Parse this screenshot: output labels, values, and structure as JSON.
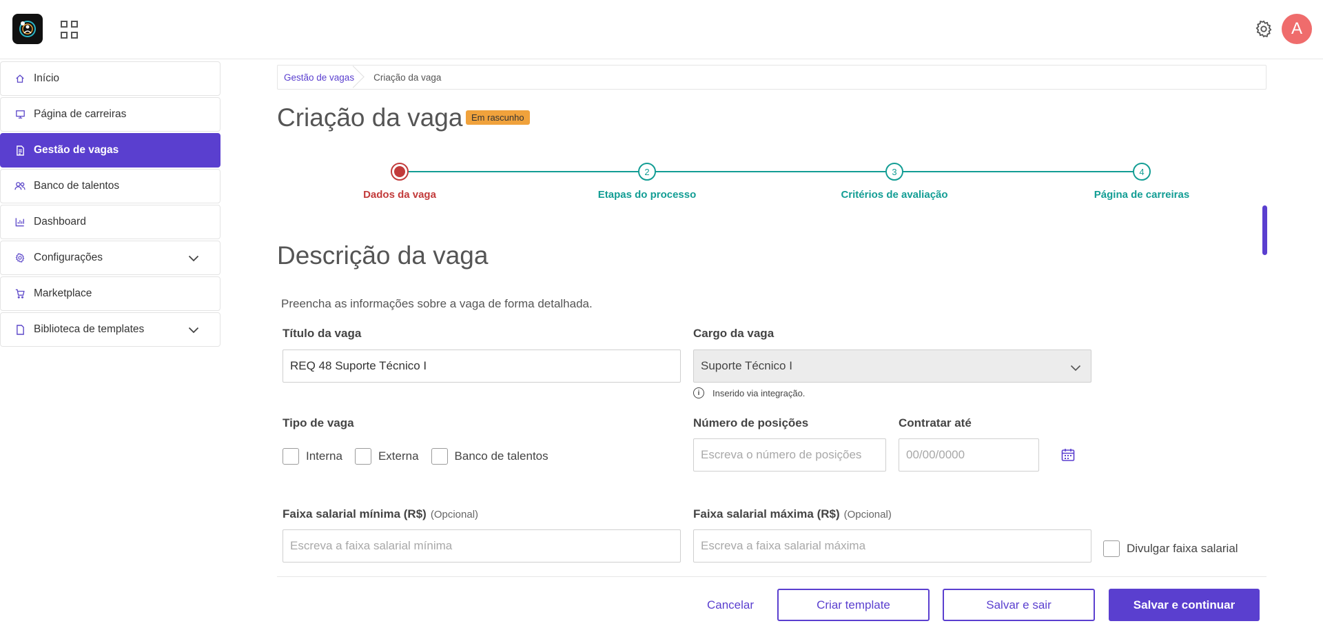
{
  "header": {
    "avatar_letter": "A"
  },
  "sidebar": {
    "items": [
      {
        "label": "Início",
        "icon": "home-icon"
      },
      {
        "label": "Página de carreiras",
        "icon": "monitor-icon"
      },
      {
        "label": "Gestão de vagas",
        "icon": "document-icon",
        "active": true
      },
      {
        "label": "Banco de talentos",
        "icon": "users-icon"
      },
      {
        "label": "Dashboard",
        "icon": "chart-icon"
      },
      {
        "label": "Configurações",
        "icon": "gear-icon",
        "expandable": true
      },
      {
        "label": "Marketplace",
        "icon": "cart-icon"
      },
      {
        "label": "Biblioteca de templates",
        "icon": "file-icon",
        "expandable": true
      }
    ]
  },
  "breadcrumb": {
    "parent": "Gestão de vagas",
    "current": "Criação da vaga"
  },
  "page": {
    "title": "Criação da vaga",
    "badge": "Em rascunho"
  },
  "stepper": {
    "steps": [
      {
        "number": "",
        "label": "Dados da vaga",
        "state": "current"
      },
      {
        "number": "2",
        "label": "Etapas do processo",
        "state": "pending"
      },
      {
        "number": "3",
        "label": "Critérios de avaliação",
        "state": "pending"
      },
      {
        "number": "4",
        "label": "Página de carreiras",
        "state": "pending"
      }
    ]
  },
  "section": {
    "title": "Descrição da vaga",
    "description": "Preencha as informações sobre a vaga de forma detalhada."
  },
  "form": {
    "titulo": {
      "label": "Título da vaga",
      "value": "REQ 48 Suporte Técnico I"
    },
    "cargo": {
      "label": "Cargo da vaga",
      "value": "Suporte Técnico I",
      "hint": "Inserido via integração."
    },
    "tipo": {
      "label": "Tipo de vaga",
      "options": [
        "Interna",
        "Externa",
        "Banco de talentos"
      ]
    },
    "posicoes": {
      "label": "Número de posições",
      "placeholder": "Escreva o número de posições"
    },
    "contratar": {
      "label": "Contratar até",
      "placeholder": "00/00/0000"
    },
    "salario_min": {
      "label": "Faixa salarial mínima (R$)",
      "optional": "(Opcional)",
      "placeholder": "Escreva a faixa salarial mínima"
    },
    "salario_max": {
      "label": "Faixa salarial máxima (R$)",
      "optional": "(Opcional)",
      "placeholder": "Escreva a faixa salarial máxima"
    },
    "divulgar": {
      "label": "Divulgar faixa salarial"
    }
  },
  "footer": {
    "cancel": "Cancelar",
    "template": "Criar template",
    "save_exit": "Salvar e sair",
    "save_continue": "Salvar e continuar"
  },
  "colors": {
    "accent": "#5a3fcf",
    "teal": "#129d94",
    "current_step": "#c23a3a",
    "badge": "#f0a23c"
  }
}
